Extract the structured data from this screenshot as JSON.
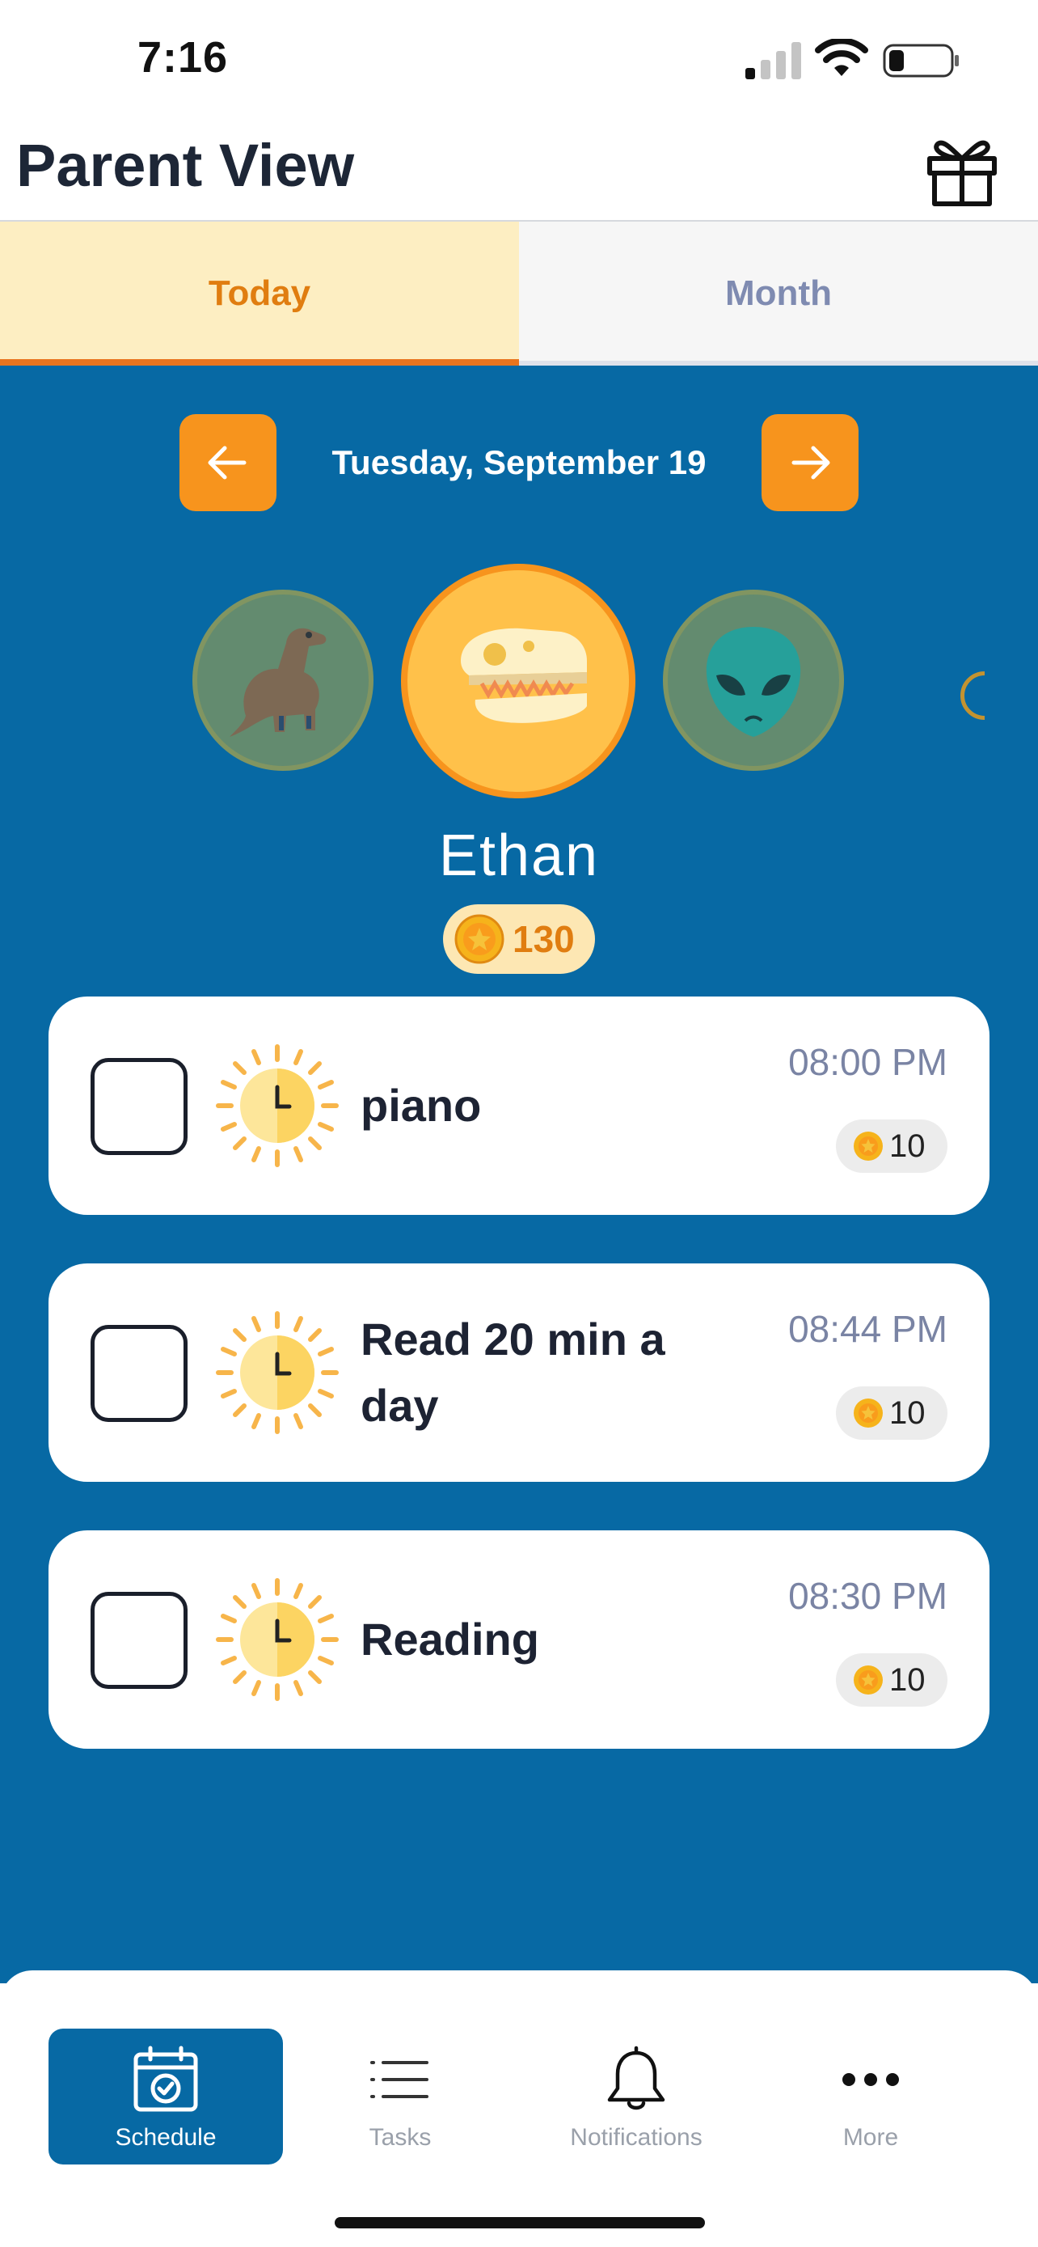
{
  "status_bar": {
    "time": "7:16"
  },
  "header": {
    "title": "Parent View",
    "gift_icon": "gift-icon"
  },
  "tabs": [
    {
      "label": "Today",
      "active": true
    },
    {
      "label": "Month",
      "active": false
    }
  ],
  "date_nav": {
    "date": "Tuesday, September 19",
    "prev_icon": "arrow-left-icon",
    "next_icon": "arrow-right-icon"
  },
  "avatars": [
    {
      "icon": "dinosaur-icon",
      "selected": false
    },
    {
      "icon": "dinosaur-skull-icon",
      "selected": true
    },
    {
      "icon": "alien-icon",
      "selected": false
    }
  ],
  "child": {
    "name": "Ethan",
    "coins": "130"
  },
  "tasks": [
    {
      "title": "piano",
      "time": "08:00 PM",
      "coins": "10",
      "done": false,
      "icon": "sun-clock-icon"
    },
    {
      "title": "Read 20 min a day",
      "time": "08:44 PM",
      "coins": "10",
      "done": false,
      "icon": "sun-clock-icon"
    },
    {
      "title": "Reading",
      "time": "08:30 PM",
      "coins": "10",
      "done": false,
      "icon": "sun-clock-icon"
    }
  ],
  "bottom_nav": [
    {
      "label": "Schedule",
      "icon": "calendar-check-icon",
      "active": true
    },
    {
      "label": "Tasks",
      "icon": "list-icon",
      "active": false
    },
    {
      "label": "Notifications",
      "icon": "bell-icon",
      "active": false
    },
    {
      "label": "More",
      "icon": "more-dots-icon",
      "active": false
    }
  ],
  "colors": {
    "primary_blue": "#0769a4",
    "accent_orange": "#f7941d",
    "today_tab_bg": "#fdeec2",
    "coin_gold": "#f6b31b"
  }
}
